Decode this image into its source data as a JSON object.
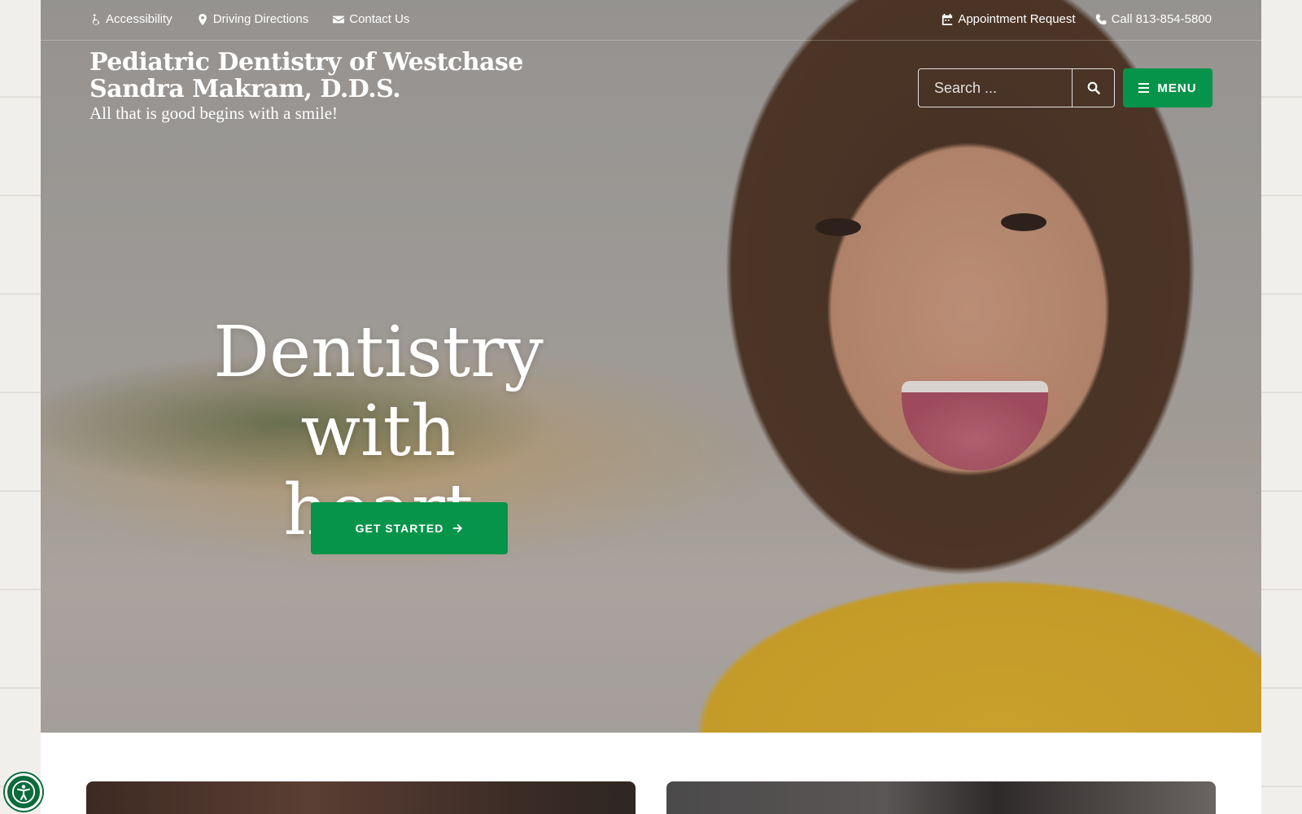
{
  "topbar": {
    "left": [
      {
        "label": "Accessibility",
        "icon": "wheelchair-icon"
      },
      {
        "label": "Driving Directions",
        "icon": "map-marker-icon"
      },
      {
        "label": "Contact Us",
        "icon": "envelope-icon"
      }
    ],
    "right": [
      {
        "label": "Appointment Request",
        "icon": "calendar-icon"
      },
      {
        "label": "Call 813-854-5800",
        "icon": "phone-icon"
      }
    ]
  },
  "brand": {
    "line1": "Pediatric Dentistry of Westchase",
    "line2": "Sandra Makram, D.D.S.",
    "tagline": "All that is good begins with a smile!"
  },
  "search": {
    "placeholder": "Search ...",
    "icon": "search-icon"
  },
  "menu": {
    "label": "MENU",
    "icon": "hamburger-icon"
  },
  "hero": {
    "headline_line1": "Dentistry",
    "headline_line2": "with heart",
    "cta_label": "GET STARTED",
    "cta_icon": "arrow-right-icon"
  },
  "colors": {
    "accent_green": "#06944a",
    "a11y_green": "#0b6b3a"
  },
  "a11y_widget": {
    "icon": "accessibility-person-icon"
  }
}
